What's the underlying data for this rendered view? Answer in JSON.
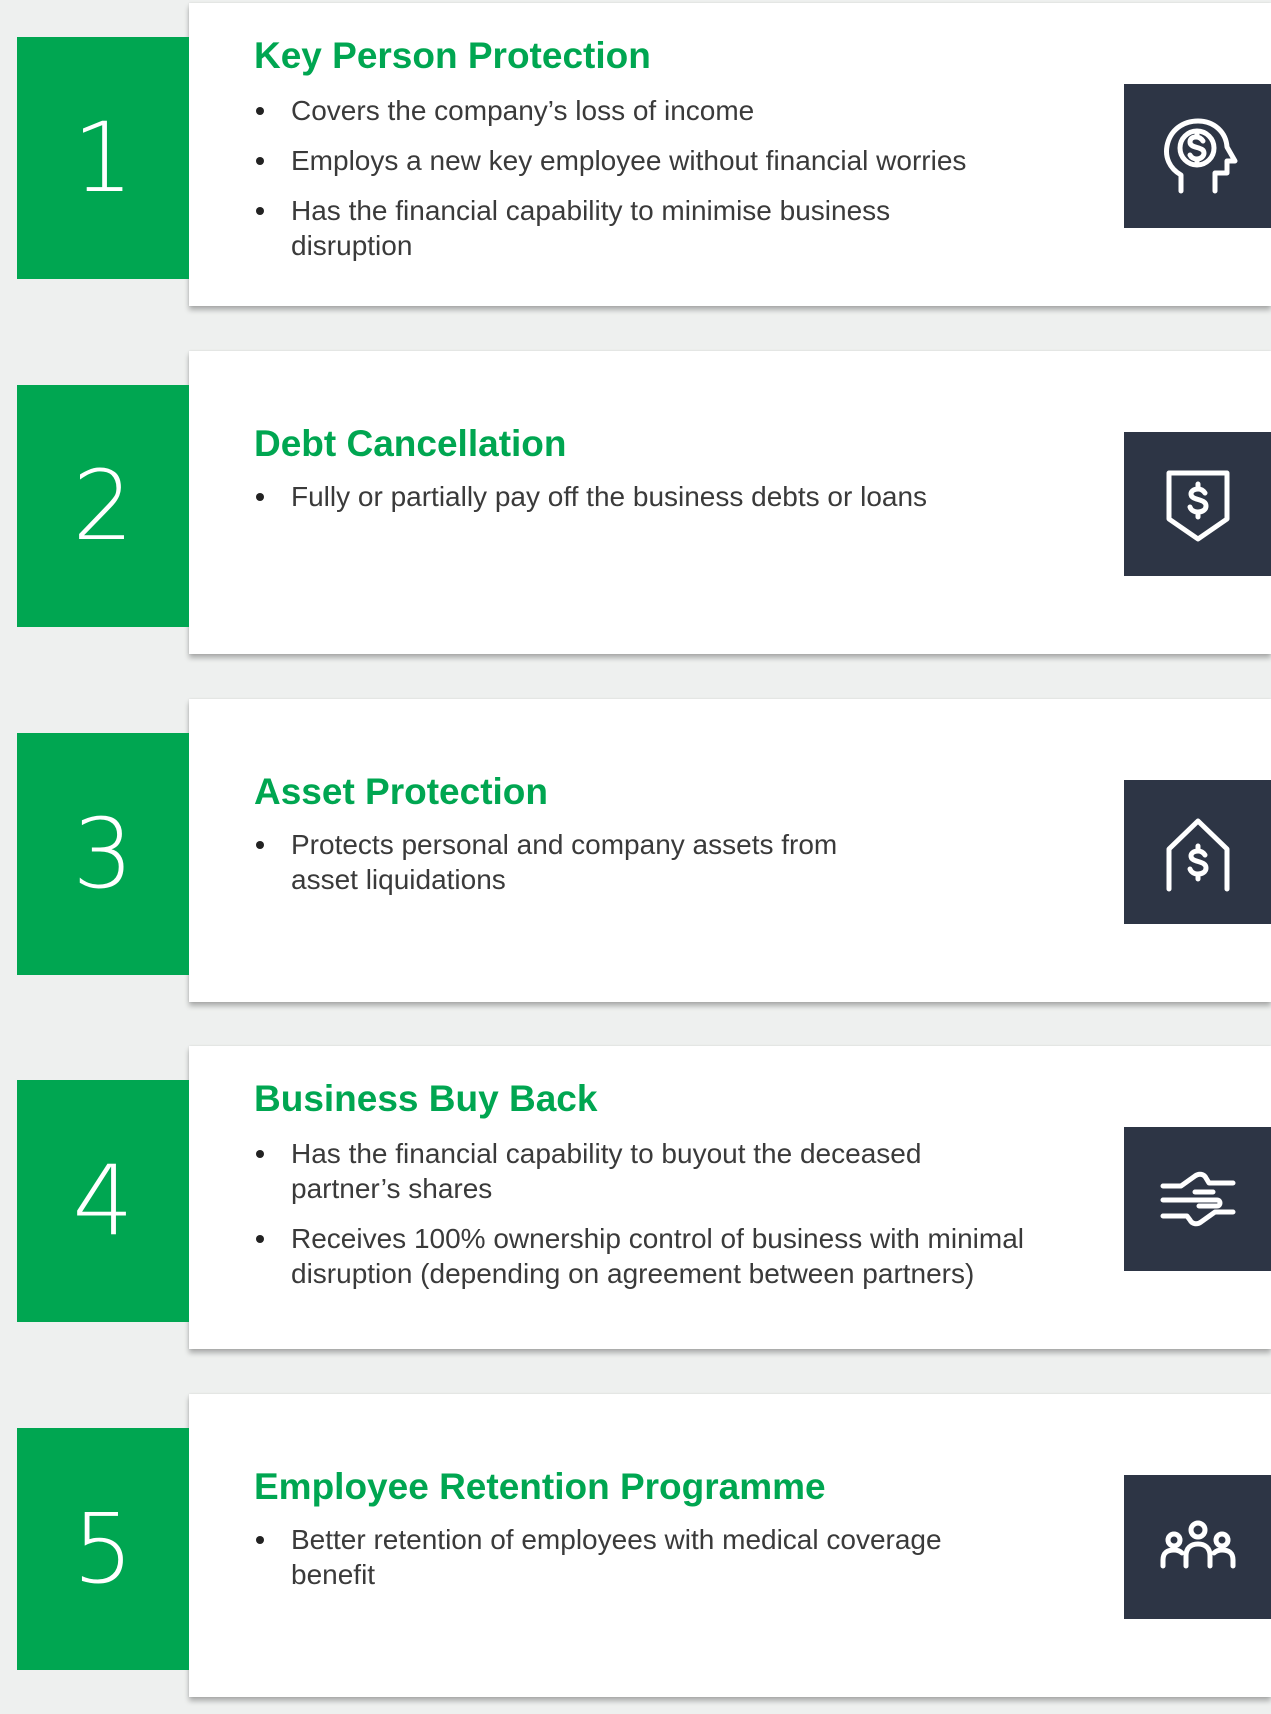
{
  "items": [
    {
      "number": "1",
      "title": "Key Person Protection",
      "bullets": [
        "Covers the company’s loss of income",
        "Employs a new key employee without financial worries",
        "Has the financial capability to minimise business disruption"
      ],
      "icon": "person-dollar-icon"
    },
    {
      "number": "2",
      "title": "Debt Cancellation",
      "bullets": [
        "Fully or partially pay off the business debts or loans"
      ],
      "icon": "shield-dollar-icon"
    },
    {
      "number": "3",
      "title": "Asset Protection",
      "bullets": [
        "Protects personal and company assets from asset liquidations"
      ],
      "icon": "house-dollar-icon"
    },
    {
      "number": "4",
      "title": "Business Buy Back",
      "bullets": [
        "Has the financial capability to buyout the deceased partner’s shares",
        "Receives 100% ownership control of business with minimal disruption (depending on agreement between partners)"
      ],
      "icon": "handshake-icon"
    },
    {
      "number": "5",
      "title": "Employee Retention Programme",
      "bullets": [
        "Better retention of employees with medical coverage benefit"
      ],
      "icon": "group-people-icon"
    }
  ],
  "colors": {
    "accent_green": "#00a651",
    "icon_background": "#2d3545",
    "page_background": "#eef0ef",
    "card_background": "#ffffff",
    "body_text": "#3a3a3a"
  }
}
